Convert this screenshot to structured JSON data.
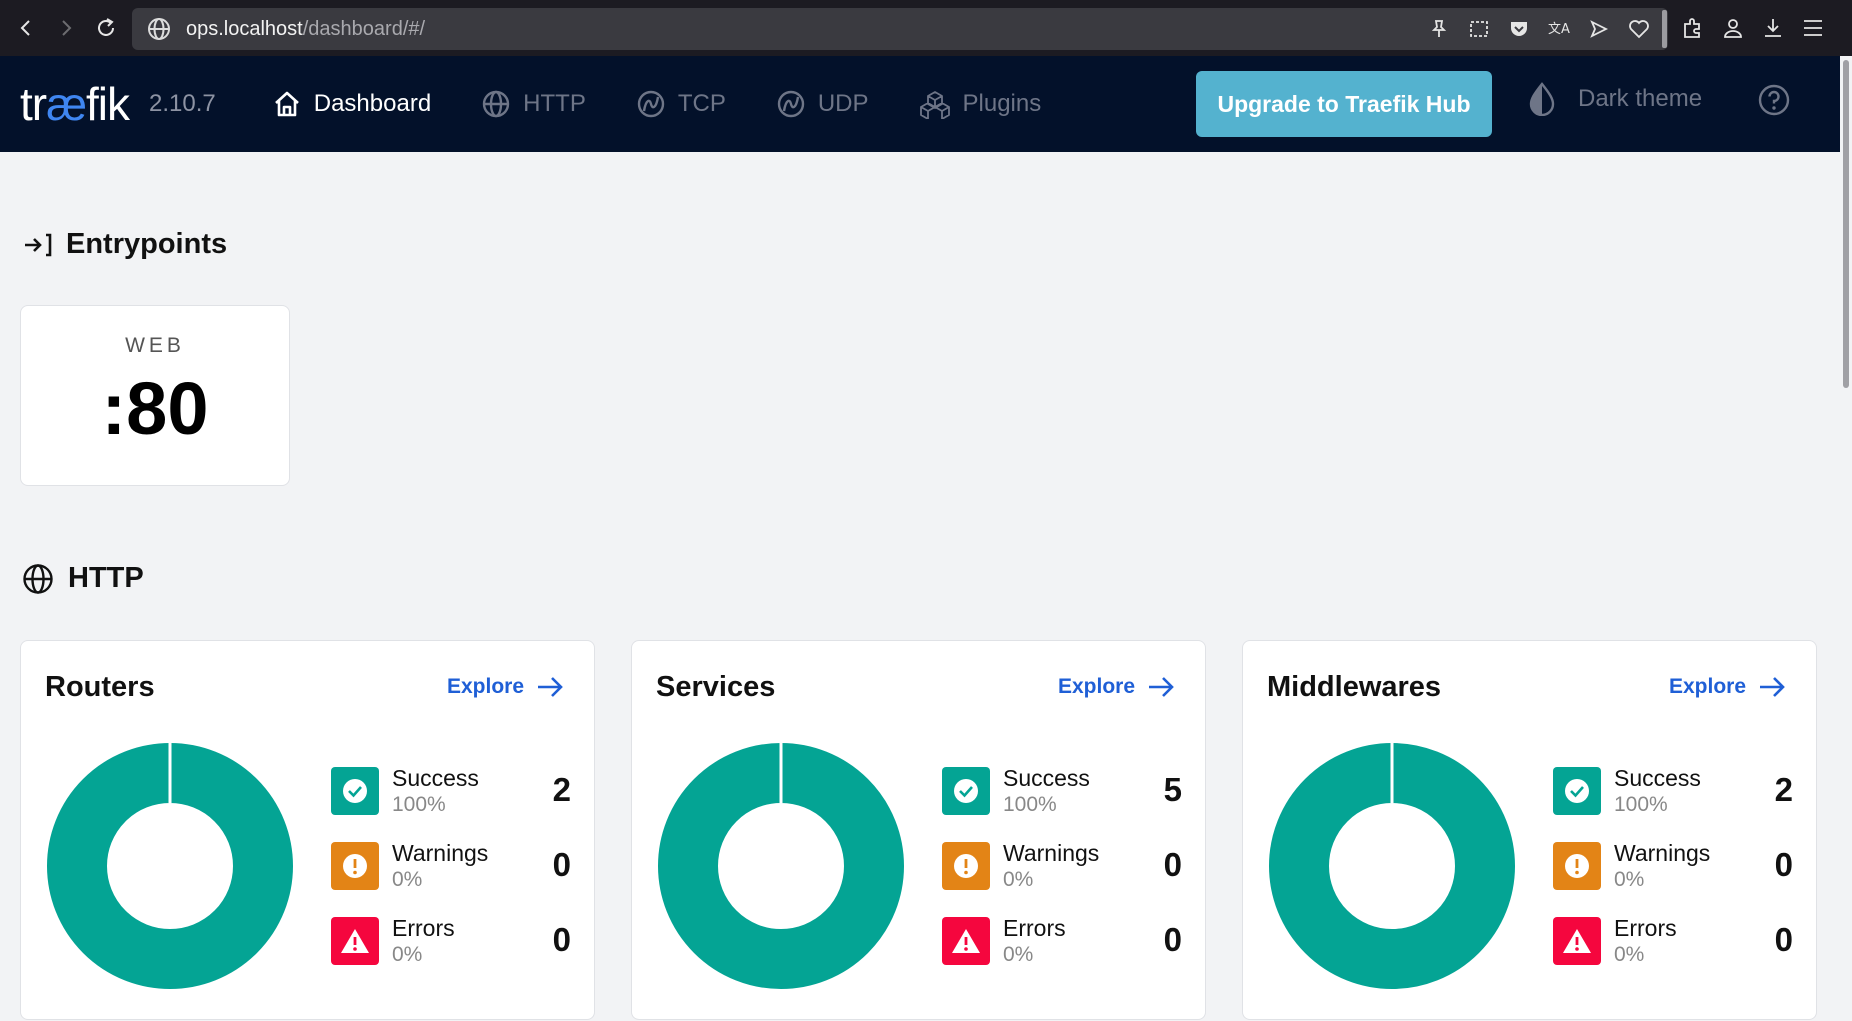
{
  "browser": {
    "url_host": "ops.localhost",
    "url_path": "/dashboard/#/"
  },
  "header": {
    "logo_pre": "tr",
    "logo_ae": "æ",
    "logo_post": "fik",
    "version": "2.10.7",
    "nav": [
      {
        "label": "Dashboard",
        "icon": "home-icon"
      },
      {
        "label": "HTTP",
        "icon": "globe-icon"
      },
      {
        "label": "TCP",
        "icon": "tcp-icon"
      },
      {
        "label": "UDP",
        "icon": "udp-icon"
      },
      {
        "label": "Plugins",
        "icon": "plugins-icon"
      }
    ],
    "upgrade_label": "Upgrade to Traefik Hub",
    "dark_theme_label": "Dark theme"
  },
  "entrypoints": {
    "title": "Entrypoints",
    "items": [
      {
        "name": "WEB",
        "port": ":80"
      }
    ]
  },
  "http": {
    "title": "HTTP",
    "cards": [
      {
        "title": "Routers",
        "explore": "Explore",
        "success": {
          "label": "Success",
          "pct": "100%",
          "count": "2"
        },
        "warnings": {
          "label": "Warnings",
          "pct": "0%",
          "count": "0"
        },
        "errors": {
          "label": "Errors",
          "pct": "0%",
          "count": "0"
        }
      },
      {
        "title": "Services",
        "explore": "Explore",
        "success": {
          "label": "Success",
          "pct": "100%",
          "count": "5"
        },
        "warnings": {
          "label": "Warnings",
          "pct": "0%",
          "count": "0"
        },
        "errors": {
          "label": "Errors",
          "pct": "0%",
          "count": "0"
        }
      },
      {
        "title": "Middlewares",
        "explore": "Explore",
        "success": {
          "label": "Success",
          "pct": "100%",
          "count": "2"
        },
        "warnings": {
          "label": "Warnings",
          "pct": "0%",
          "count": "0"
        },
        "errors": {
          "label": "Errors",
          "pct": "0%",
          "count": "0"
        }
      }
    ]
  },
  "colors": {
    "success": "#04a494",
    "warning": "#e38416",
    "error": "#f5063e",
    "accent": "#54b2cf",
    "header_bg": "#03112a"
  }
}
